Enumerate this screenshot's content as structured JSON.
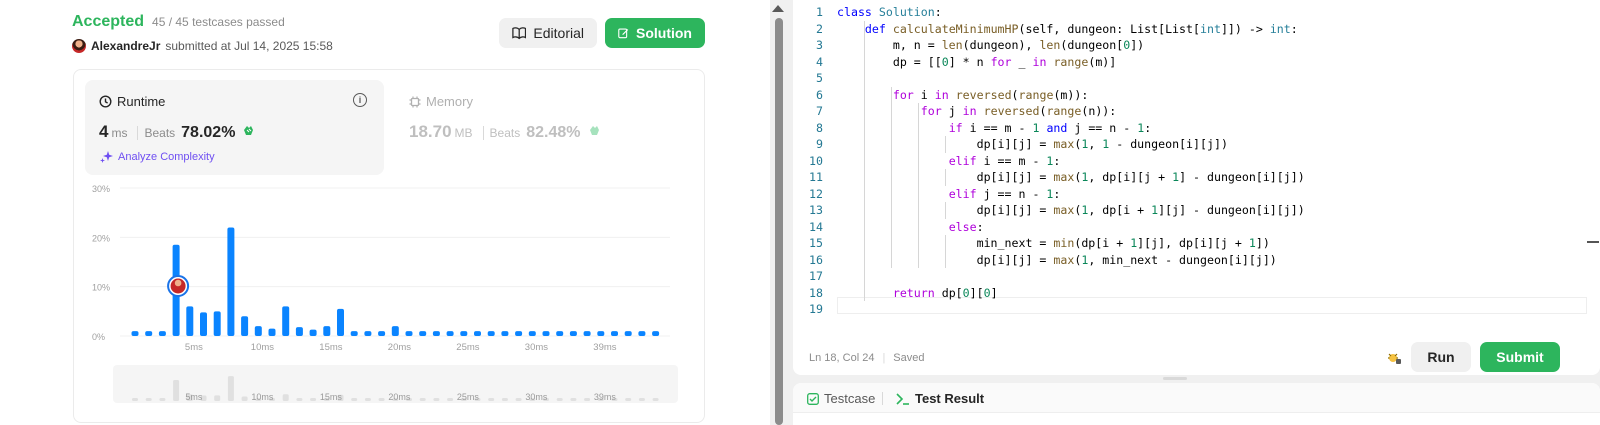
{
  "submission": {
    "status": "Accepted",
    "tests": "45 / 45 testcases passed",
    "author": "AlexandreJr",
    "submitted": "submitted at Jul 14, 2025 15:58"
  },
  "actions": {
    "editorial": "Editorial",
    "solution": "Solution"
  },
  "runtime": {
    "title": "Runtime",
    "value": "4",
    "unit": "ms",
    "beats_label": "Beats",
    "beats": "78.02%",
    "analyze": "Analyze Complexity"
  },
  "memory": {
    "title": "Memory",
    "value": "18.70",
    "unit": "MB",
    "beats_label": "Beats",
    "beats": "82.48%"
  },
  "chart_data": {
    "type": "bar",
    "y_ticks": [
      "30%",
      "20%",
      "10%",
      "0%"
    ],
    "ylim": [
      0,
      30
    ],
    "x_ticks": [
      "5ms",
      "10ms",
      "15ms",
      "20ms",
      "25ms",
      "30ms",
      "39ms"
    ],
    "values": [
      1,
      1,
      1,
      18.5,
      6,
      4.8,
      5,
      22,
      4,
      2,
      1.5,
      6,
      1.8,
      1.3,
      2,
      5.5,
      1,
      1,
      1,
      2,
      1,
      1,
      1,
      1,
      1,
      1,
      1,
      1,
      1,
      1,
      1,
      1,
      1,
      1,
      1,
      1,
      1,
      1,
      1
    ],
    "highlight_index": 4,
    "grid": true,
    "colors": {
      "bar": "#0a84ff",
      "grid": "#f0f0f0",
      "overview": "#e0e0e0"
    }
  },
  "code": {
    "lines": [
      [
        [
          "kw",
          "class"
        ],
        [
          "pl",
          " "
        ],
        [
          "cls",
          "Solution"
        ],
        [
          "pl",
          ":"
        ]
      ],
      [
        [
          "pl",
          "    "
        ],
        [
          "kw",
          "def"
        ],
        [
          "pl",
          " "
        ],
        [
          "fn",
          "calculateMinimumHP"
        ],
        [
          "pl",
          "(self, dungeon: List[List["
        ],
        [
          "ty",
          "int"
        ],
        [
          "pl",
          "]]) -> "
        ],
        [
          "ty",
          "int"
        ],
        [
          "pl",
          ":"
        ]
      ],
      [
        [
          "pl",
          "        m, n = "
        ],
        [
          "fn",
          "len"
        ],
        [
          "pl",
          "(dungeon), "
        ],
        [
          "fn",
          "len"
        ],
        [
          "pl",
          "(dungeon["
        ],
        [
          "nm",
          "0"
        ],
        [
          "pl",
          "])"
        ]
      ],
      [
        [
          "pl",
          "        dp = [["
        ],
        [
          "nm",
          "0"
        ],
        [
          "pl",
          "] * n "
        ],
        [
          "kc",
          "for"
        ],
        [
          "pl",
          " _ "
        ],
        [
          "kc",
          "in"
        ],
        [
          "pl",
          " "
        ],
        [
          "fn",
          "range"
        ],
        [
          "pl",
          "(m)]"
        ]
      ],
      [
        [
          "pl",
          ""
        ]
      ],
      [
        [
          "pl",
          "        "
        ],
        [
          "kc",
          "for"
        ],
        [
          "pl",
          " i "
        ],
        [
          "kc",
          "in"
        ],
        [
          "pl",
          " "
        ],
        [
          "fn",
          "reversed"
        ],
        [
          "pl",
          "("
        ],
        [
          "fn",
          "range"
        ],
        [
          "pl",
          "(m)):"
        ]
      ],
      [
        [
          "pl",
          "            "
        ],
        [
          "kc",
          "for"
        ],
        [
          "pl",
          " j "
        ],
        [
          "kc",
          "in"
        ],
        [
          "pl",
          " "
        ],
        [
          "fn",
          "reversed"
        ],
        [
          "pl",
          "("
        ],
        [
          "fn",
          "range"
        ],
        [
          "pl",
          "(n)):"
        ]
      ],
      [
        [
          "pl",
          "                "
        ],
        [
          "kc",
          "if"
        ],
        [
          "pl",
          " i == m - "
        ],
        [
          "nm",
          "1"
        ],
        [
          "pl",
          " "
        ],
        [
          "kw",
          "and"
        ],
        [
          "pl",
          " j == n - "
        ],
        [
          "nm",
          "1"
        ],
        [
          "pl",
          ":"
        ]
      ],
      [
        [
          "pl",
          "                    dp[i][j] = "
        ],
        [
          "fn",
          "max"
        ],
        [
          "pl",
          "("
        ],
        [
          "nm",
          "1"
        ],
        [
          "pl",
          ", "
        ],
        [
          "nm",
          "1"
        ],
        [
          "pl",
          " - dungeon[i][j])"
        ]
      ],
      [
        [
          "pl",
          "                "
        ],
        [
          "kc",
          "elif"
        ],
        [
          "pl",
          " i == m - "
        ],
        [
          "nm",
          "1"
        ],
        [
          "pl",
          ":"
        ]
      ],
      [
        [
          "pl",
          "                    dp[i][j] = "
        ],
        [
          "fn",
          "max"
        ],
        [
          "pl",
          "("
        ],
        [
          "nm",
          "1"
        ],
        [
          "pl",
          ", dp[i][j + "
        ],
        [
          "nm",
          "1"
        ],
        [
          "pl",
          "] - dungeon[i][j])"
        ]
      ],
      [
        [
          "pl",
          "                "
        ],
        [
          "kc",
          "elif"
        ],
        [
          "pl",
          " j == n - "
        ],
        [
          "nm",
          "1"
        ],
        [
          "pl",
          ":"
        ]
      ],
      [
        [
          "pl",
          "                    dp[i][j] = "
        ],
        [
          "fn",
          "max"
        ],
        [
          "pl",
          "("
        ],
        [
          "nm",
          "1"
        ],
        [
          "pl",
          ", dp[i + "
        ],
        [
          "nm",
          "1"
        ],
        [
          "pl",
          "][j] - dungeon[i][j])"
        ]
      ],
      [
        [
          "pl",
          "                "
        ],
        [
          "kc",
          "else"
        ],
        [
          "pl",
          ":"
        ]
      ],
      [
        [
          "pl",
          "                    min_next = "
        ],
        [
          "fn",
          "min"
        ],
        [
          "pl",
          "(dp[i + "
        ],
        [
          "nm",
          "1"
        ],
        [
          "pl",
          "][j], dp[i][j + "
        ],
        [
          "nm",
          "1"
        ],
        [
          "pl",
          "])"
        ]
      ],
      [
        [
          "pl",
          "                    dp[i][j] = "
        ],
        [
          "fn",
          "max"
        ],
        [
          "pl",
          "("
        ],
        [
          "nm",
          "1"
        ],
        [
          "pl",
          ", min_next - dungeon[i][j])"
        ]
      ],
      [
        [
          "pl",
          ""
        ]
      ],
      [
        [
          "pl",
          "        "
        ],
        [
          "kc",
          "return"
        ],
        [
          "pl",
          " dp["
        ],
        [
          "nm",
          "0"
        ],
        [
          "pl",
          "]["
        ],
        [
          "nm",
          "0"
        ],
        [
          "pl",
          "]"
        ]
      ],
      [
        [
          "pl",
          ""
        ]
      ]
    ]
  },
  "editor": {
    "position": "Ln 18, Col 24",
    "saved": "Saved",
    "run": "Run",
    "submit": "Submit"
  },
  "console": {
    "testcase": "Testcase",
    "result": "Test Result"
  }
}
